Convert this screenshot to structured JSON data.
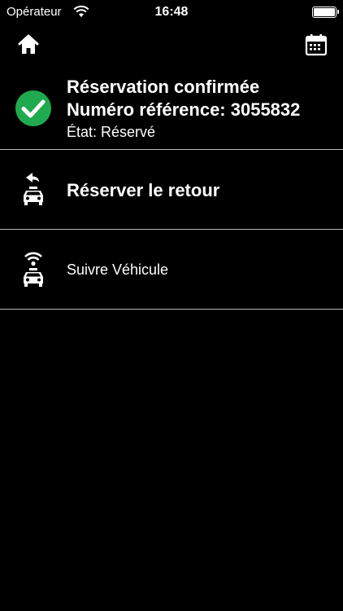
{
  "status_bar": {
    "carrier": "Opérateur",
    "time": "16:48"
  },
  "nav": {
    "home_icon": "home-icon",
    "calendar_icon": "calendar-icon"
  },
  "booking": {
    "title": "Réservation confirmée",
    "reference": "Numéro référence: 3055832",
    "state": "État: Réservé",
    "status_color": "#1faa4f"
  },
  "actions": [
    {
      "label": "Réserver le retour",
      "icon": "taxi-return-icon"
    },
    {
      "label": "Suivre Véhicule",
      "icon": "taxi-tracking-icon"
    }
  ]
}
